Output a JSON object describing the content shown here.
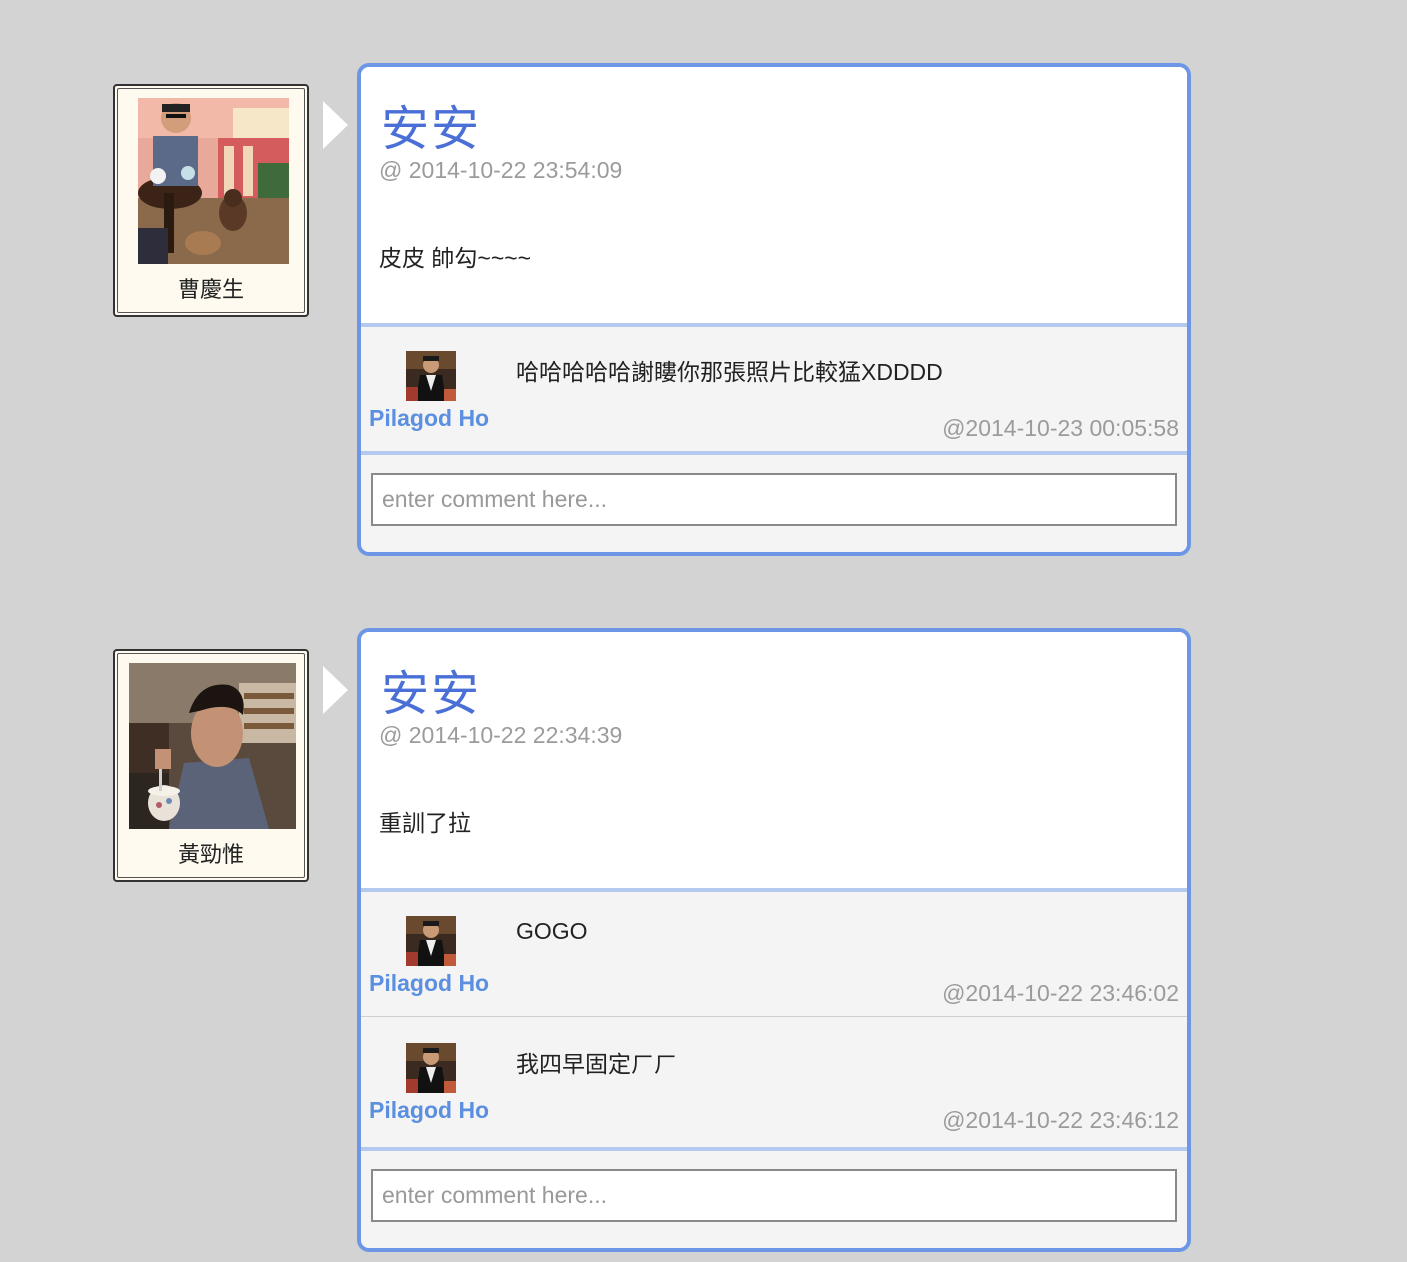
{
  "posts": [
    {
      "author": "曹慶生",
      "title": "安安",
      "time": "@ 2014-10-22 23:54:09",
      "text": "皮皮 帥勾~~~~",
      "comments": [
        {
          "user": "Pilagod Ho",
          "text": "哈哈哈哈哈謝瞜你那張照片比較猛XDDDD",
          "time": "@2014-10-23 00:05:58"
        }
      ],
      "comment_placeholder": "enter comment here..."
    },
    {
      "author": "黃勁惟",
      "title": "安安",
      "time": "@ 2014-10-22 22:34:39",
      "text": "重訓了拉",
      "comments": [
        {
          "user": "Pilagod Ho",
          "text": "GOGO",
          "time": "@2014-10-22 23:46:02"
        },
        {
          "user": "Pilagod Ho",
          "text": "我四早固定ㄏㄏ",
          "time": "@2014-10-22 23:46:12"
        }
      ],
      "comment_placeholder": "enter comment here..."
    }
  ],
  "colors": {
    "background": "#d3d3d3",
    "card_border": "#6d97e6",
    "title": "#4a6fd6",
    "username": "#5b8fe0",
    "timestamp": "#9b9b9b"
  }
}
